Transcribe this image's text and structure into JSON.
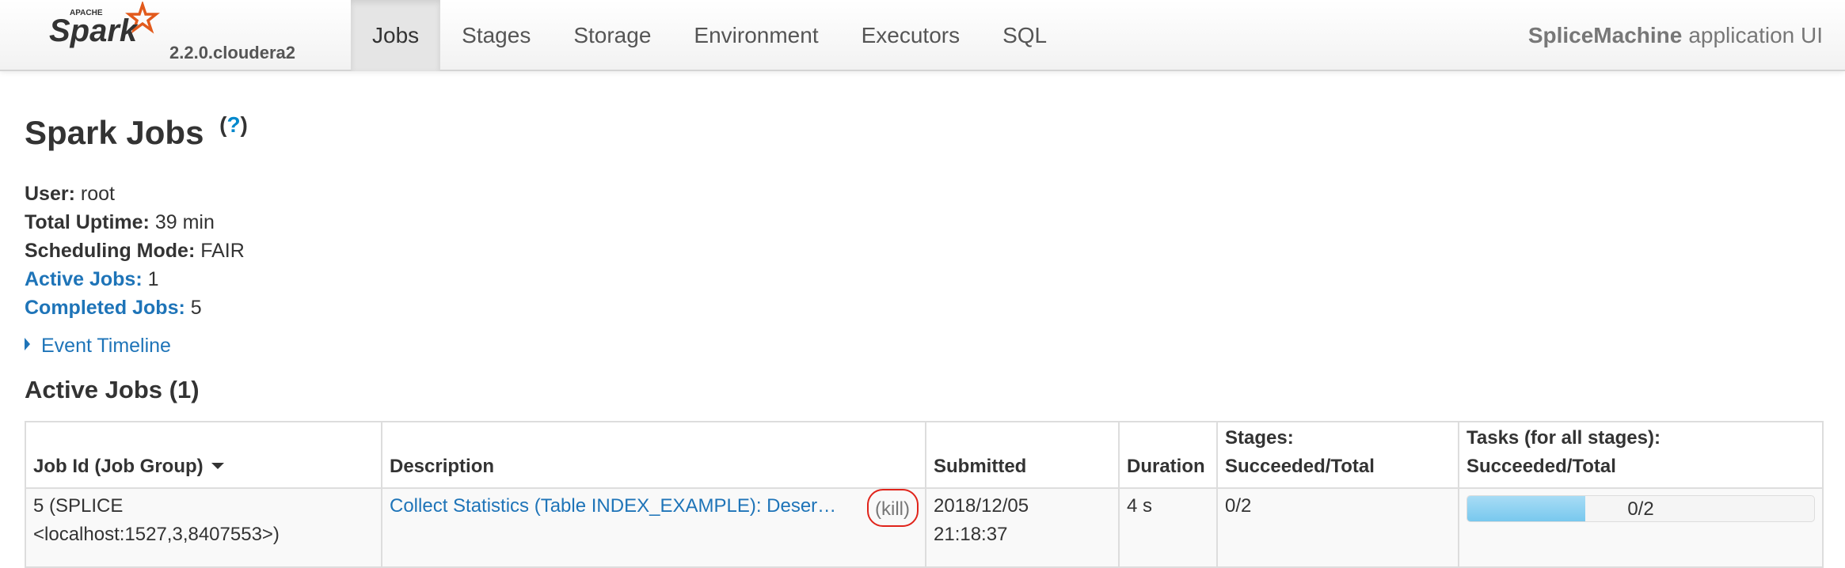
{
  "navbar": {
    "brand_small": "APACHE",
    "brand_name": "Spark",
    "version": "2.2.0.cloudera2",
    "tabs": [
      {
        "label": "Jobs",
        "active": true
      },
      {
        "label": "Stages"
      },
      {
        "label": "Storage"
      },
      {
        "label": "Environment"
      },
      {
        "label": "Executors"
      },
      {
        "label": "SQL"
      }
    ],
    "app_name_bold": "SpliceMachine",
    "app_name_rest": "application UI"
  },
  "page": {
    "title": "Spark Jobs",
    "help": "?"
  },
  "summary": {
    "user_label": "User:",
    "user_value": "root",
    "uptime_label": "Total Uptime:",
    "uptime_value": "39 min",
    "mode_label": "Scheduling Mode:",
    "mode_value": "FAIR",
    "active_label": "Active Jobs:",
    "active_value": "1",
    "completed_label": "Completed Jobs:",
    "completed_value": "5"
  },
  "timeline": {
    "label": "Event Timeline"
  },
  "active_jobs": {
    "title": "Active Jobs (1)",
    "columns": {
      "job_id": "Job Id (Job Group)",
      "description": "Description",
      "submitted": "Submitted",
      "duration": "Duration",
      "stages_line1": "Stages:",
      "stages_line2": "Succeeded/Total",
      "tasks_line1": "Tasks (for all stages):",
      "tasks_line2": "Succeeded/Total"
    },
    "rows": [
      {
        "job_id_line1": "5 (SPLICE",
        "job_id_line2": "<localhost:1527,3,8407553>)",
        "description": "Collect Statistics (Table INDEX_EXAMPLE): Deser…",
        "kill": "(kill)",
        "submitted_date": "2018/12/05",
        "submitted_time": "21:18:37",
        "duration": "4 s",
        "stages": "0/2",
        "tasks": "0/2",
        "tasks_progress_fraction": 0.34
      }
    ]
  },
  "colors": {
    "link": "#1e74b8",
    "kill_highlight": "#e0241b",
    "progress_fill": "#78c8ee",
    "spark_orange": "#e25a1c"
  }
}
